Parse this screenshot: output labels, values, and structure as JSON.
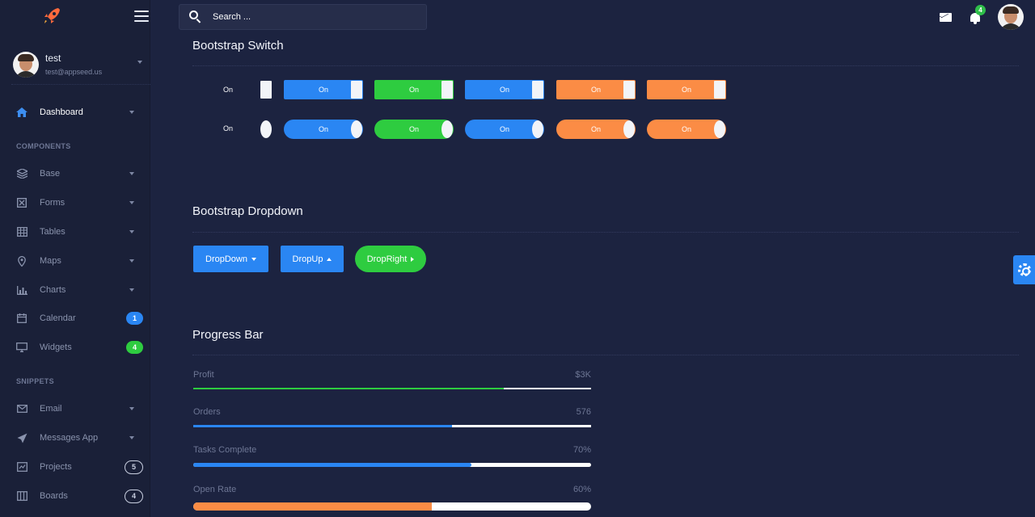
{
  "sidebar": {
    "user": {
      "name": "test",
      "email": "test@appseed.us"
    },
    "dashboard_label": "Dashboard",
    "components_label": "COMPONENTS",
    "snippets_label": "SNIPPETS",
    "items": [
      {
        "label": "Base",
        "icon": "layers-icon"
      },
      {
        "label": "Forms",
        "icon": "form-icon"
      },
      {
        "label": "Tables",
        "icon": "table-icon"
      },
      {
        "label": "Maps",
        "icon": "map-pin-icon"
      },
      {
        "label": "Charts",
        "icon": "bar-chart-icon"
      },
      {
        "label": "Calendar",
        "icon": "calendar-icon",
        "badge": "1"
      },
      {
        "label": "Widgets",
        "icon": "monitor-icon",
        "badge": "4"
      },
      {
        "label": "Email",
        "icon": "mail-icon"
      },
      {
        "label": "Messages App",
        "icon": "rocket-icon"
      },
      {
        "label": "Projects",
        "icon": "projects-icon",
        "badge": "5"
      },
      {
        "label": "Boards",
        "icon": "boards-icon",
        "badge": "4"
      }
    ]
  },
  "topbar": {
    "search_placeholder": "Search ...",
    "notification_count": "4"
  },
  "switches": {
    "title": "Bootstrap Switch",
    "row_label": "On",
    "switch_label": "On"
  },
  "dropdowns": {
    "title": "Bootstrap Dropdown",
    "dropdown_label": "DropDown",
    "dropup_label": "DropUp",
    "dropright_label": "DropRight"
  },
  "progress": {
    "title": "Progress Bar",
    "rows": [
      {
        "label": "Profit",
        "value": "$3K",
        "fill_percent": 78,
        "color": "#2ecc40"
      },
      {
        "label": "Orders",
        "value": "576",
        "fill_percent": 65,
        "color": "#2a86f3"
      },
      {
        "label": "Tasks Complete",
        "value": "70%",
        "fill_percent": 70,
        "color": "#2a86f3"
      },
      {
        "label": "Open Rate",
        "value": "60%",
        "fill_percent": 60,
        "color": "#fb8c45"
      }
    ]
  },
  "colors": {
    "background": "#1c2340",
    "sidebar": "#1a2038",
    "blue": "#2a86f3",
    "green": "#2ecc40",
    "orange": "#fb8c45"
  }
}
